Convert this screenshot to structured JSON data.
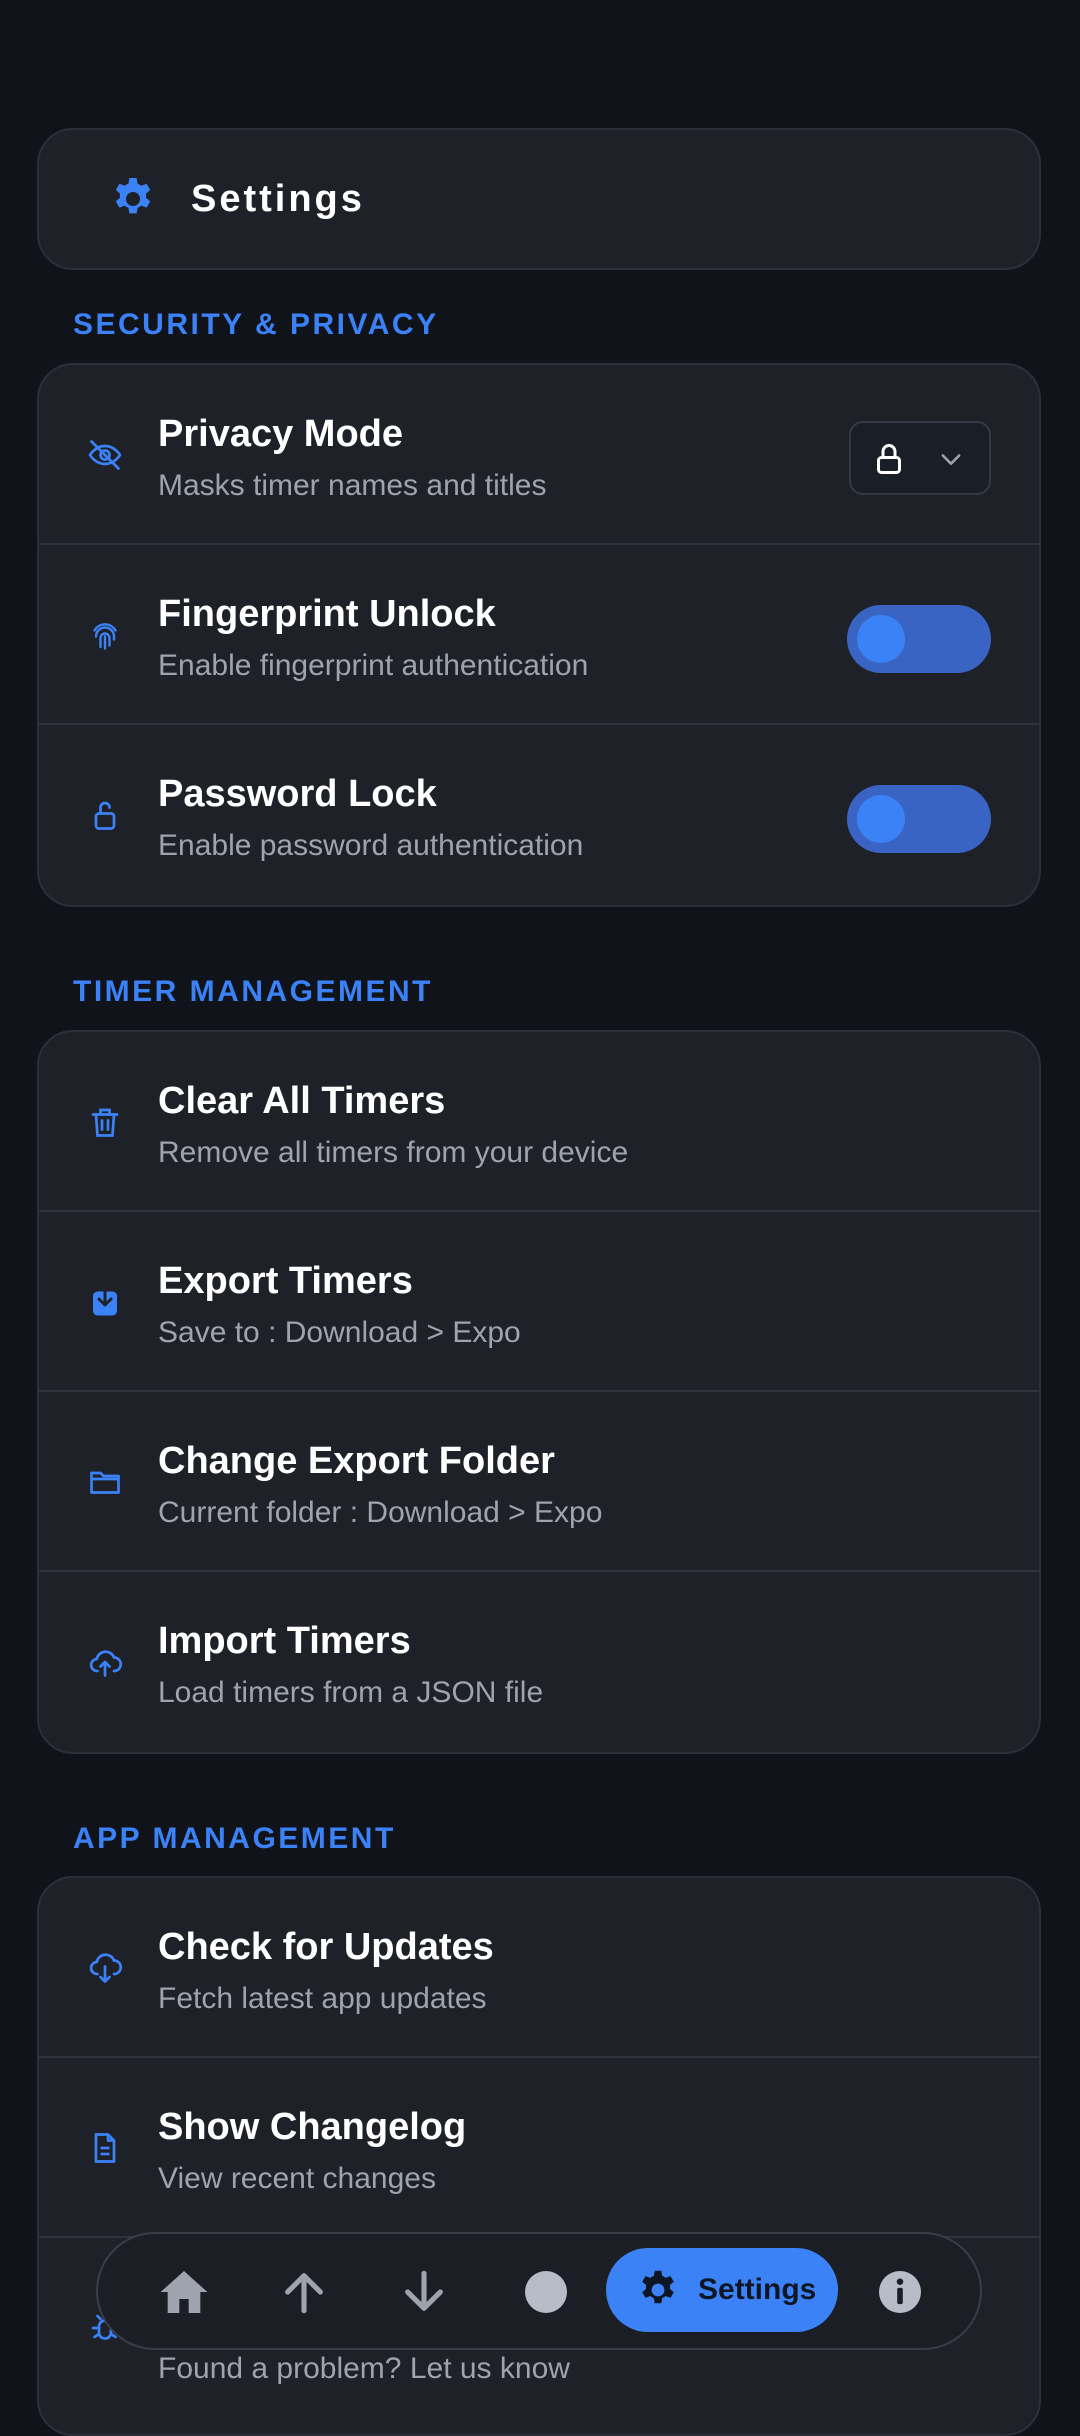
{
  "header": {
    "title": "Settings",
    "icon": "gear-icon"
  },
  "colors": {
    "accent": "#3b82f6",
    "background": "#11131a",
    "card": "#1f2128",
    "subtitle": "#9ea3ad"
  },
  "security": {
    "title": "SECURITY & PRIVACY",
    "privacy_mode": {
      "title": "Privacy Mode",
      "subtitle": "Masks timer names and titles",
      "icon": "eye-off-icon",
      "select_icon": "lock-icon"
    },
    "fingerprint": {
      "title": "Fingerprint Unlock",
      "subtitle": "Enable fingerprint authentication",
      "icon": "fingerprint-icon",
      "enabled": false
    },
    "password": {
      "title": "Password Lock",
      "subtitle": "Enable password authentication",
      "icon": "unlock-icon",
      "enabled": false
    }
  },
  "timers": {
    "title": "TIMER MANAGEMENT",
    "clear": {
      "title": "Clear All Timers",
      "subtitle": "Remove all timers from your device",
      "icon": "trash-icon"
    },
    "export": {
      "title": "Export Timers",
      "subtitle": "Save to :  Download > Expo",
      "icon": "download-icon"
    },
    "folder": {
      "title": "Change Export Folder",
      "subtitle": "Current folder :  Download > Expo",
      "icon": "folder-icon"
    },
    "import": {
      "title": "Import Timers",
      "subtitle": "Load timers from a JSON file",
      "icon": "cloud-upload-icon"
    }
  },
  "app": {
    "title": "APP MANAGEMENT",
    "updates": {
      "title": "Check for Updates",
      "subtitle": "Fetch latest app updates",
      "icon": "cloud-download-icon"
    },
    "changelog": {
      "title": "Show Changelog",
      "subtitle": "View recent changes",
      "icon": "document-icon"
    },
    "bug": {
      "subtitle": "Found a problem? Let us know",
      "icon": "bug-icon"
    }
  },
  "nav": {
    "items": [
      "home-icon",
      "arrow-up-icon",
      "arrow-down-icon",
      "circle-icon",
      "gear-icon",
      "info-icon"
    ],
    "active_label": "Settings"
  }
}
